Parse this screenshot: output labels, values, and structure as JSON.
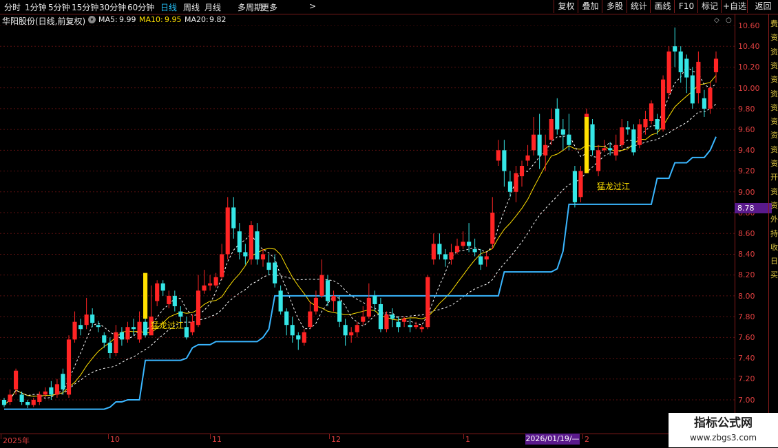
{
  "period_tabs": [
    {
      "label": "分时",
      "active": false
    },
    {
      "label": "1分钟",
      "active": false
    },
    {
      "label": "5分钟",
      "active": false
    },
    {
      "label": "15分钟",
      "active": false
    },
    {
      "label": "30分钟",
      "active": false
    },
    {
      "label": "60分钟",
      "active": false
    },
    {
      "label": "日线",
      "active": true
    },
    {
      "label": "周线",
      "active": false
    },
    {
      "label": "月线",
      "active": false
    },
    {
      "label": "多周期",
      "active": false
    },
    {
      "label": "更多",
      "active": false
    }
  ],
  "more_chevron": ">",
  "toolbar": {
    "buttons": [
      "复权",
      "叠加",
      "多股",
      "统计",
      "画线",
      "F10",
      "标记",
      "+自选",
      "返回"
    ]
  },
  "info": {
    "stock_name": "华阳股份(日线,前复权)",
    "ma5_label": "MA5:",
    "ma5_value": "9.99",
    "ma10_label": "MA10:",
    "ma10_value": "9.95",
    "ma20_label": "MA20:",
    "ma20_value": "9.82"
  },
  "colors": {
    "up": "#ff2424",
    "down": "#35e6e6",
    "ma5": "#ffffff",
    "ma10": "#ffe000",
    "ma20": "#ffffff",
    "trail": "#3ab6ff",
    "signal": "#ffe000",
    "grid": "#5a1010",
    "axis_text": "#e04040"
  },
  "y_axis": {
    "ticks": [
      "10.60",
      "10.40",
      "10.20",
      "10.00",
      "9.80",
      "9.60",
      "9.40",
      "9.20",
      "9.00",
      "8.80",
      "8.60",
      "8.40",
      "8.20",
      "8.00",
      "7.80",
      "7.60",
      "7.40",
      "7.20",
      "7.00"
    ]
  },
  "current_price_tag": "8.78",
  "x_axis": {
    "labels": [
      "2025年",
      "10",
      "11",
      "12",
      "1",
      "2"
    ],
    "cursor_date": "2026/01/19/—"
  },
  "signals": [
    {
      "label": "猛龙过江"
    },
    {
      "label": "猛龙过江"
    }
  ],
  "right_strip_chars": [
    "费",
    "资",
    "资",
    "资",
    "资",
    "资",
    "资",
    "资",
    "资",
    "资",
    "资",
    "开",
    "资",
    "资",
    "外",
    "持",
    "收",
    "日",
    "买"
  ],
  "watermark": {
    "title": "指标公式网",
    "url": "www.zbgs3.com"
  },
  "chart_data": {
    "type": "candlestick",
    "title": "华阳股份(日线,前复权)",
    "y_range": [
      6.95,
      10.7
    ],
    "candles": [
      [
        7.0,
        6.95,
        7.02,
        6.93
      ],
      [
        6.98,
        7.05,
        7.1,
        6.95
      ],
      [
        7.1,
        7.28,
        7.3,
        7.05
      ],
      [
        7.05,
        6.98,
        7.08,
        6.95
      ],
      [
        6.98,
        6.95,
        7.0,
        6.92
      ],
      [
        6.95,
        7.0,
        7.02,
        6.93
      ],
      [
        6.98,
        7.05,
        7.08,
        6.95
      ],
      [
        7.05,
        7.08,
        7.12,
        7.02
      ],
      [
        7.12,
        7.05,
        7.18,
        7.0
      ],
      [
        7.05,
        7.15,
        7.2,
        7.02
      ],
      [
        7.25,
        7.1,
        7.3,
        7.05
      ],
      [
        7.05,
        7.58,
        7.62,
        7.02
      ],
      [
        7.58,
        7.75,
        7.85,
        7.55
      ],
      [
        7.72,
        7.68,
        7.78,
        7.62
      ],
      [
        7.72,
        7.82,
        7.98,
        7.68
      ],
      [
        7.82,
        7.74,
        7.88,
        7.7
      ],
      [
        7.72,
        7.7,
        7.76,
        7.65
      ],
      [
        7.62,
        7.55,
        7.65,
        7.5
      ],
      [
        7.55,
        7.45,
        7.6,
        7.4
      ],
      [
        7.45,
        7.65,
        7.72,
        7.42
      ],
      [
        7.65,
        7.58,
        7.7,
        7.52
      ],
      [
        7.58,
        7.7,
        7.75,
        7.55
      ],
      [
        7.7,
        7.68,
        7.78,
        7.62
      ],
      [
        7.58,
        7.75,
        7.85,
        7.55
      ],
      [
        7.75,
        7.62,
        7.85,
        7.6
      ],
      [
        7.62,
        7.8,
        8.1,
        7.78
      ],
      [
        7.95,
        8.12,
        8.15,
        7.9
      ],
      [
        8.12,
        8.05,
        8.15,
        8.0
      ],
      [
        7.92,
        8.0,
        8.05,
        7.88
      ],
      [
        8.0,
        7.9,
        8.05,
        7.85
      ],
      [
        7.85,
        7.8,
        7.9,
        7.72
      ],
      [
        7.7,
        7.6,
        7.8,
        7.58
      ],
      [
        7.65,
        7.75,
        7.82,
        7.62
      ],
      [
        7.72,
        8.05,
        8.2,
        7.7
      ],
      [
        8.05,
        8.1,
        8.25,
        8.02
      ],
      [
        8.1,
        8.12,
        8.2,
        8.05
      ],
      [
        8.1,
        8.18,
        8.22,
        8.08
      ],
      [
        8.18,
        8.4,
        8.5,
        8.15
      ],
      [
        8.4,
        8.85,
        8.95,
        8.35
      ],
      [
        8.85,
        8.65,
        8.95,
        8.55
      ],
      [
        8.62,
        8.42,
        8.7,
        8.35
      ],
      [
        8.42,
        8.38,
        8.5,
        8.3
      ],
      [
        8.35,
        8.68,
        8.72,
        8.3
      ],
      [
        8.62,
        8.35,
        8.7,
        8.3
      ],
      [
        8.35,
        8.4,
        8.45,
        8.28
      ],
      [
        8.32,
        8.25,
        8.4,
        8.2
      ],
      [
        8.32,
        8.12,
        8.4,
        8.08
      ],
      [
        8.05,
        7.85,
        8.1,
        7.82
      ],
      [
        7.85,
        7.72,
        7.88,
        7.62
      ],
      [
        7.72,
        7.62,
        7.8,
        7.55
      ],
      [
        7.62,
        7.58,
        7.65,
        7.48
      ],
      [
        7.55,
        7.65,
        7.68,
        7.52
      ],
      [
        7.7,
        7.85,
        7.95,
        7.68
      ],
      [
        7.85,
        7.98,
        8.05,
        7.82
      ],
      [
        8.0,
        8.2,
        8.35,
        7.98
      ],
      [
        8.15,
        7.95,
        8.2,
        7.9
      ],
      [
        7.95,
        8.0,
        8.05,
        7.85
      ],
      [
        7.95,
        7.75,
        8.0,
        7.7
      ],
      [
        7.72,
        7.62,
        7.78,
        7.52
      ],
      [
        7.62,
        7.65,
        7.7,
        7.55
      ],
      [
        7.65,
        7.72,
        7.75,
        7.6
      ],
      [
        7.75,
        7.8,
        7.9,
        7.72
      ],
      [
        7.8,
        7.98,
        8.12,
        7.78
      ],
      [
        8.0,
        7.92,
        8.05,
        7.85
      ],
      [
        7.92,
        7.68,
        7.98,
        7.65
      ],
      [
        7.68,
        7.82,
        7.85,
        7.65
      ],
      [
        7.82,
        7.78,
        7.88,
        7.7
      ],
      [
        7.75,
        7.7,
        7.8,
        7.65
      ],
      [
        7.75,
        7.78,
        7.8,
        7.7
      ],
      [
        7.72,
        7.7,
        7.78,
        7.65
      ],
      [
        7.7,
        7.72,
        7.75,
        7.68
      ],
      [
        7.68,
        7.7,
        7.72,
        7.65
      ],
      [
        7.7,
        8.18,
        8.2,
        7.68
      ],
      [
        8.35,
        8.5,
        8.6,
        8.3
      ],
      [
        8.5,
        8.4,
        8.6,
        8.35
      ],
      [
        8.4,
        8.35,
        8.45,
        8.28
      ],
      [
        8.35,
        8.42,
        8.5,
        8.3
      ],
      [
        8.42,
        8.48,
        8.55,
        8.4
      ],
      [
        8.48,
        8.52,
        8.62,
        8.45
      ],
      [
        8.52,
        8.48,
        8.7,
        8.42
      ],
      [
        8.45,
        8.42,
        8.55,
        8.38
      ],
      [
        8.38,
        8.3,
        8.45,
        8.25
      ],
      [
        8.35,
        8.38,
        8.42,
        8.28
      ],
      [
        8.5,
        8.8,
        8.95,
        8.45
      ],
      [
        9.3,
        9.4,
        9.5,
        9.25
      ],
      [
        9.4,
        9.2,
        9.5,
        9.05
      ],
      [
        9.1,
        9.0,
        9.2,
        8.95
      ],
      [
        9.0,
        9.18,
        9.25,
        8.9
      ],
      [
        9.15,
        9.25,
        9.3,
        9.05
      ],
      [
        9.3,
        9.35,
        9.45,
        9.25
      ],
      [
        9.4,
        9.55,
        9.72,
        9.35
      ],
      [
        9.55,
        9.35,
        9.75,
        9.22
      ],
      [
        9.35,
        9.45,
        9.55,
        9.2
      ],
      [
        9.5,
        9.7,
        9.8,
        9.45
      ],
      [
        9.8,
        9.6,
        9.9,
        9.55
      ],
      [
        9.6,
        9.55,
        9.7,
        9.4
      ],
      [
        9.55,
        9.45,
        9.75,
        9.4
      ],
      [
        9.2,
        8.9,
        9.25,
        8.85
      ],
      [
        8.95,
        9.2,
        9.25,
        8.9
      ],
      [
        9.2,
        9.75,
        9.8,
        9.18
      ],
      [
        9.65,
        9.4,
        9.7,
        9.35
      ],
      [
        9.2,
        9.4,
        9.45,
        9.15
      ],
      [
        9.4,
        9.42,
        9.5,
        9.38
      ],
      [
        9.42,
        9.4,
        9.48,
        9.35
      ],
      [
        9.35,
        9.45,
        9.55,
        9.3
      ],
      [
        9.45,
        9.62,
        9.7,
        9.42
      ],
      [
        9.62,
        9.6,
        9.68,
        9.55
      ],
      [
        9.6,
        9.38,
        9.65,
        9.35
      ],
      [
        9.45,
        9.65,
        9.7,
        9.42
      ],
      [
        9.62,
        9.7,
        9.78,
        9.55
      ],
      [
        9.68,
        9.85,
        9.88,
        9.65
      ],
      [
        9.7,
        9.6,
        9.75,
        9.55
      ],
      [
        9.6,
        10.08,
        10.12,
        9.58
      ],
      [
        9.95,
        10.35,
        10.4,
        9.9
      ],
      [
        10.4,
        10.35,
        10.58,
        10.2
      ],
      [
        10.35,
        10.15,
        10.4,
        10.05
      ],
      [
        10.28,
        10.1,
        10.32,
        9.95
      ],
      [
        10.12,
        9.85,
        10.2,
        9.8
      ],
      [
        9.95,
        10.25,
        10.35,
        9.85
      ],
      [
        9.9,
        9.8,
        9.98,
        9.72
      ],
      [
        9.8,
        10.0,
        10.05,
        9.75
      ],
      [
        10.15,
        10.28,
        10.35,
        10.05
      ]
    ]
  }
}
